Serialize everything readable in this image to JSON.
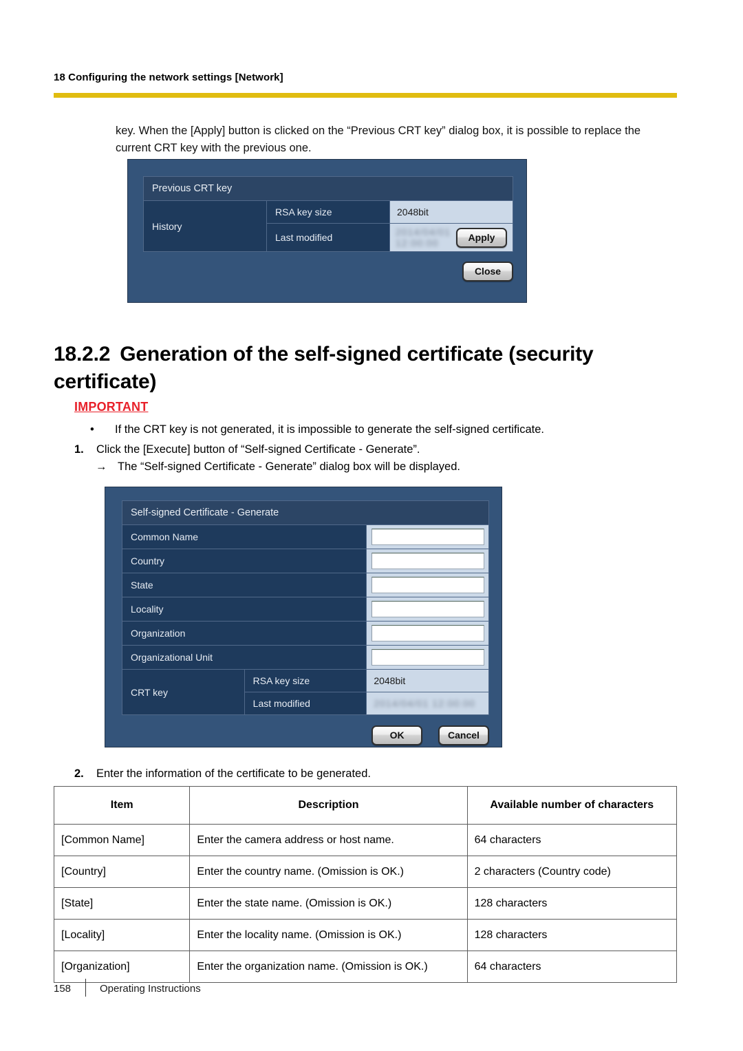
{
  "header": {
    "breadcrumb": "18 Configuring the network settings [Network]",
    "rule_color": "#e0bc10"
  },
  "intro_paragraph": "key. When the [Apply] button is clicked on the “Previous CRT key” dialog box, it is possible to replace the current CRT key with the previous one.",
  "dialog_previous_crt": {
    "title": "Previous CRT key",
    "row_group_label": "History",
    "rows": [
      {
        "label": "RSA key size",
        "value": "2048bit"
      },
      {
        "label": "Last modified",
        "value": "2014/04/01 12:00:00"
      }
    ],
    "apply_button": "Apply",
    "close_button": "Close"
  },
  "section": {
    "number": "18.2.2",
    "title": "Generation of the self-signed certificate (security certificate)"
  },
  "important": {
    "label": "IMPORTANT",
    "bullet": "If the CRT key is not generated, it is impossible to generate the self-signed certificate.",
    "bullet_marker": "•"
  },
  "steps": [
    {
      "number": "1.",
      "text": "Click the [Execute] button of “Self-signed Certificate - Generate”.",
      "substep_marker": "→",
      "substep": "The “Self-signed Certificate - Generate” dialog box will be displayed."
    },
    {
      "number": "2.",
      "text": "Enter the information of the certificate to be generated."
    }
  ],
  "dialog_selfsigned": {
    "title": "Self-signed Certificate - Generate",
    "fields": [
      {
        "label": "Common Name",
        "value": "",
        "placeholder": ""
      },
      {
        "label": "Country",
        "value": "",
        "placeholder": ""
      },
      {
        "label": "State",
        "value": "",
        "placeholder": ""
      },
      {
        "label": "Locality",
        "value": "",
        "placeholder": ""
      },
      {
        "label": "Organization",
        "value": "",
        "placeholder": ""
      },
      {
        "label": "Organizational Unit",
        "value": "",
        "placeholder": ""
      }
    ],
    "crt_group_label": "CRT key",
    "crt_rows": [
      {
        "label": "RSA key size",
        "value": "2048bit"
      },
      {
        "label": "Last modified",
        "value": "2014/04/01 12:00:00"
      }
    ],
    "ok_button": "OK",
    "cancel_button": "Cancel"
  },
  "table": {
    "headers": [
      "Item",
      "Description",
      "Available number of characters"
    ],
    "rows": [
      [
        "[Common Name]",
        "Enter the camera address or host name.",
        "64 characters"
      ],
      [
        "[Country]",
        "Enter the country name. (Omission is OK.)",
        "2 characters (Country code)"
      ],
      [
        "[State]",
        "Enter the state name. (Omission is OK.)",
        "128 characters"
      ],
      [
        "[Locality]",
        "Enter the locality name. (Omission is OK.)",
        "128 characters"
      ],
      [
        "[Organization]",
        "Enter the organization name. (Omission is OK.)",
        "64 characters"
      ]
    ]
  },
  "footer": {
    "page_number": "158",
    "doc_title": "Operating Instructions"
  }
}
